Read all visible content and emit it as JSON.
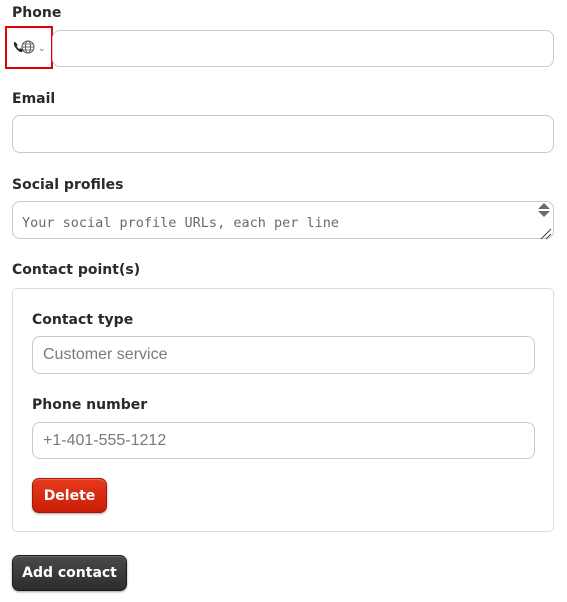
{
  "phone": {
    "label": "Phone",
    "country_selector_icon": "phone-globe-icon",
    "country_selector_chevron": "⌄",
    "value": "",
    "placeholder": ""
  },
  "email": {
    "label": "Email",
    "value": "",
    "placeholder": ""
  },
  "social_profiles": {
    "label": "Social profiles",
    "value": "",
    "placeholder": "Your social profile URLs, each per line"
  },
  "contact_points": {
    "label": "Contact point(s)",
    "items": [
      {
        "contact_type": {
          "label": "Contact type",
          "value": "",
          "placeholder": "Customer service"
        },
        "phone_number": {
          "label": "Phone number",
          "value": "",
          "placeholder": "+1-401-555-1212"
        },
        "delete_label": "Delete"
      }
    ],
    "add_label": "Add contact"
  },
  "colors": {
    "highlight_border": "#e0000a",
    "delete_button": "#d0260a",
    "add_button": "#333333",
    "input_border": "#c9c9c9"
  }
}
